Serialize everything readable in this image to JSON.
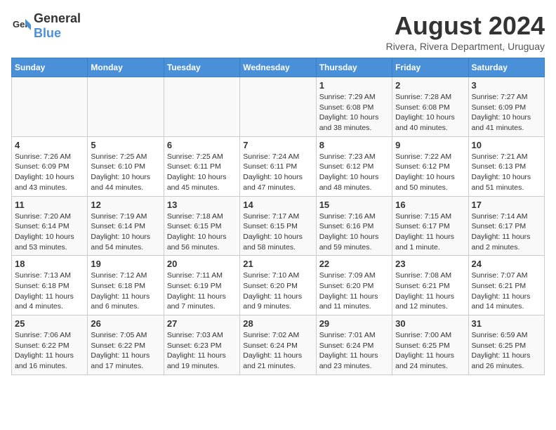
{
  "logo": {
    "text_general": "General",
    "text_blue": "Blue"
  },
  "title": "August 2024",
  "subtitle": "Rivera, Rivera Department, Uruguay",
  "days_header": [
    "Sunday",
    "Monday",
    "Tuesday",
    "Wednesday",
    "Thursday",
    "Friday",
    "Saturday"
  ],
  "weeks": [
    [
      {
        "day": "",
        "info": ""
      },
      {
        "day": "",
        "info": ""
      },
      {
        "day": "",
        "info": ""
      },
      {
        "day": "",
        "info": ""
      },
      {
        "day": "1",
        "info": "Sunrise: 7:29 AM\nSunset: 6:08 PM\nDaylight: 10 hours\nand 38 minutes."
      },
      {
        "day": "2",
        "info": "Sunrise: 7:28 AM\nSunset: 6:08 PM\nDaylight: 10 hours\nand 40 minutes."
      },
      {
        "day": "3",
        "info": "Sunrise: 7:27 AM\nSunset: 6:09 PM\nDaylight: 10 hours\nand 41 minutes."
      }
    ],
    [
      {
        "day": "4",
        "info": "Sunrise: 7:26 AM\nSunset: 6:09 PM\nDaylight: 10 hours\nand 43 minutes."
      },
      {
        "day": "5",
        "info": "Sunrise: 7:25 AM\nSunset: 6:10 PM\nDaylight: 10 hours\nand 44 minutes."
      },
      {
        "day": "6",
        "info": "Sunrise: 7:25 AM\nSunset: 6:11 PM\nDaylight: 10 hours\nand 45 minutes."
      },
      {
        "day": "7",
        "info": "Sunrise: 7:24 AM\nSunset: 6:11 PM\nDaylight: 10 hours\nand 47 minutes."
      },
      {
        "day": "8",
        "info": "Sunrise: 7:23 AM\nSunset: 6:12 PM\nDaylight: 10 hours\nand 48 minutes."
      },
      {
        "day": "9",
        "info": "Sunrise: 7:22 AM\nSunset: 6:12 PM\nDaylight: 10 hours\nand 50 minutes."
      },
      {
        "day": "10",
        "info": "Sunrise: 7:21 AM\nSunset: 6:13 PM\nDaylight: 10 hours\nand 51 minutes."
      }
    ],
    [
      {
        "day": "11",
        "info": "Sunrise: 7:20 AM\nSunset: 6:14 PM\nDaylight: 10 hours\nand 53 minutes."
      },
      {
        "day": "12",
        "info": "Sunrise: 7:19 AM\nSunset: 6:14 PM\nDaylight: 10 hours\nand 54 minutes."
      },
      {
        "day": "13",
        "info": "Sunrise: 7:18 AM\nSunset: 6:15 PM\nDaylight: 10 hours\nand 56 minutes."
      },
      {
        "day": "14",
        "info": "Sunrise: 7:17 AM\nSunset: 6:15 PM\nDaylight: 10 hours\nand 58 minutes."
      },
      {
        "day": "15",
        "info": "Sunrise: 7:16 AM\nSunset: 6:16 PM\nDaylight: 10 hours\nand 59 minutes."
      },
      {
        "day": "16",
        "info": "Sunrise: 7:15 AM\nSunset: 6:17 PM\nDaylight: 11 hours\nand 1 minute."
      },
      {
        "day": "17",
        "info": "Sunrise: 7:14 AM\nSunset: 6:17 PM\nDaylight: 11 hours\nand 2 minutes."
      }
    ],
    [
      {
        "day": "18",
        "info": "Sunrise: 7:13 AM\nSunset: 6:18 PM\nDaylight: 11 hours\nand 4 minutes."
      },
      {
        "day": "19",
        "info": "Sunrise: 7:12 AM\nSunset: 6:18 PM\nDaylight: 11 hours\nand 6 minutes."
      },
      {
        "day": "20",
        "info": "Sunrise: 7:11 AM\nSunset: 6:19 PM\nDaylight: 11 hours\nand 7 minutes."
      },
      {
        "day": "21",
        "info": "Sunrise: 7:10 AM\nSunset: 6:20 PM\nDaylight: 11 hours\nand 9 minutes."
      },
      {
        "day": "22",
        "info": "Sunrise: 7:09 AM\nSunset: 6:20 PM\nDaylight: 11 hours\nand 11 minutes."
      },
      {
        "day": "23",
        "info": "Sunrise: 7:08 AM\nSunset: 6:21 PM\nDaylight: 11 hours\nand 12 minutes."
      },
      {
        "day": "24",
        "info": "Sunrise: 7:07 AM\nSunset: 6:21 PM\nDaylight: 11 hours\nand 14 minutes."
      }
    ],
    [
      {
        "day": "25",
        "info": "Sunrise: 7:06 AM\nSunset: 6:22 PM\nDaylight: 11 hours\nand 16 minutes."
      },
      {
        "day": "26",
        "info": "Sunrise: 7:05 AM\nSunset: 6:22 PM\nDaylight: 11 hours\nand 17 minutes."
      },
      {
        "day": "27",
        "info": "Sunrise: 7:03 AM\nSunset: 6:23 PM\nDaylight: 11 hours\nand 19 minutes."
      },
      {
        "day": "28",
        "info": "Sunrise: 7:02 AM\nSunset: 6:24 PM\nDaylight: 11 hours\nand 21 minutes."
      },
      {
        "day": "29",
        "info": "Sunrise: 7:01 AM\nSunset: 6:24 PM\nDaylight: 11 hours\nand 23 minutes."
      },
      {
        "day": "30",
        "info": "Sunrise: 7:00 AM\nSunset: 6:25 PM\nDaylight: 11 hours\nand 24 minutes."
      },
      {
        "day": "31",
        "info": "Sunrise: 6:59 AM\nSunset: 6:25 PM\nDaylight: 11 hours\nand 26 minutes."
      }
    ]
  ]
}
